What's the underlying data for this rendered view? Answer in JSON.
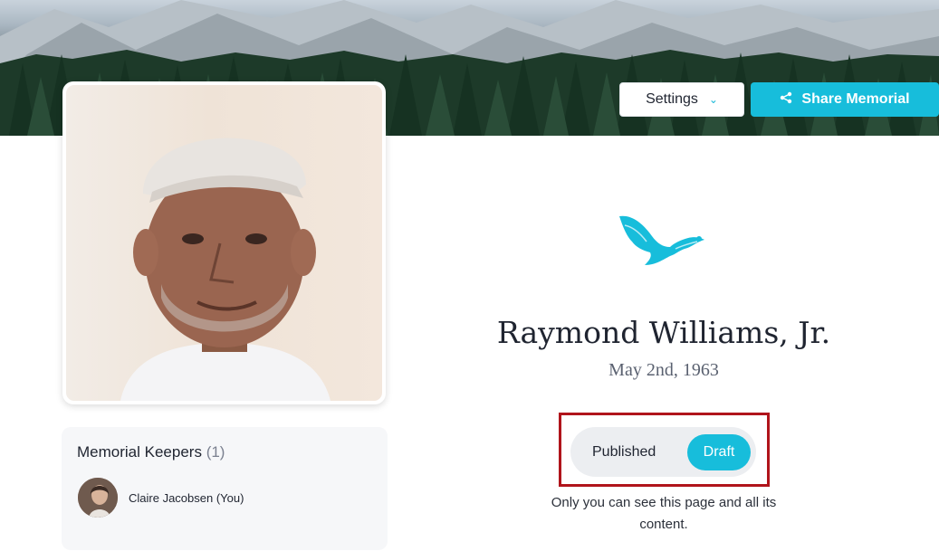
{
  "header": {
    "settings_label": "Settings",
    "share_label": "Share Memorial"
  },
  "profile": {
    "name": "Raymond Williams, Jr.",
    "date": "May 2nd, 1963"
  },
  "keepers": {
    "title": "Memorial Keepers",
    "count": "(1)",
    "items": [
      {
        "name": "Claire Jacobsen (You)"
      }
    ]
  },
  "status_toggle": {
    "published_label": "Published",
    "draft_label": "Draft",
    "selected": "Draft"
  },
  "notice": "Only you can see this page and all its content.",
  "colors": {
    "accent": "#17bddb",
    "highlight": "#b0141b"
  },
  "icons": {
    "settings_chevron": "chevron-down-icon",
    "share": "share-icon",
    "emblem": "eagle-icon"
  }
}
